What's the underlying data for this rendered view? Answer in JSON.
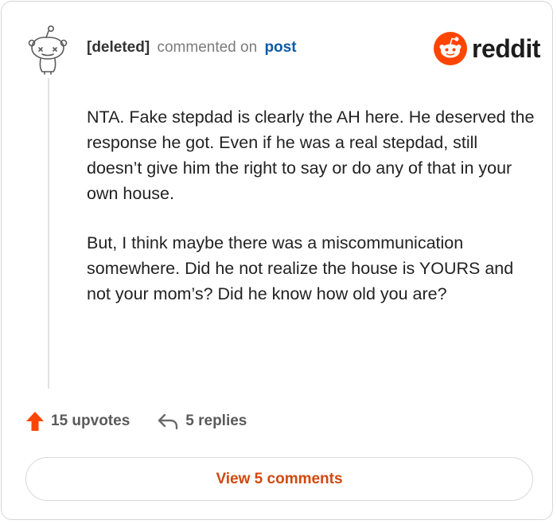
{
  "header": {
    "author": "[deleted]",
    "action": "commented on",
    "post_link": "post"
  },
  "logo": {
    "text": "reddit",
    "icon": "reddit-snoo-icon",
    "brand_color": "#ff4500"
  },
  "comment": {
    "paragraphs": [
      "NTA. Fake stepdad is clearly the AH here. He deserved the response he got. Even if he was a real stepdad, still doesn’t give him the right to say or do any of that in your own house.",
      "But, I think maybe there was a miscommunication somewhere. Did he not realize the house is YOURS and not your mom’s? Did he know how old you are?"
    ]
  },
  "stats": {
    "upvotes": "15 upvotes",
    "upvote_icon": "upvote-arrow-icon",
    "replies": "5 replies",
    "reply_icon": "reply-arrow-icon"
  },
  "view_button": {
    "label": "View 5 comments",
    "color": "#d1490f"
  }
}
